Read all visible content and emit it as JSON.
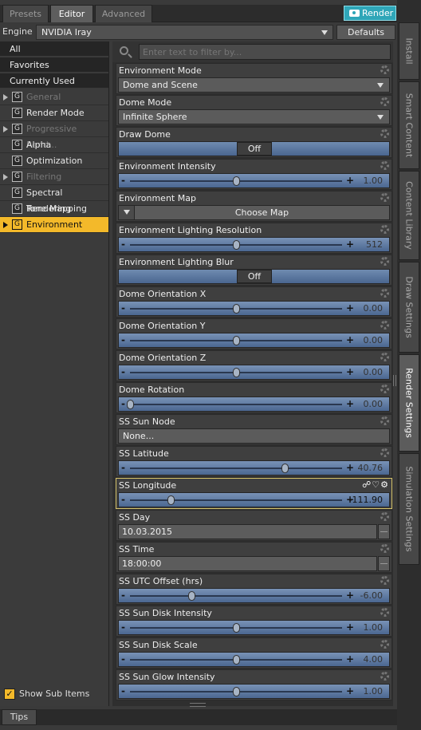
{
  "tabs": {
    "presets": "Presets",
    "editor": "Editor",
    "advanced": "Advanced"
  },
  "render_button": "Render",
  "engine": {
    "label": "Engine :",
    "value": "NVIDIA Iray",
    "defaults": "Defaults"
  },
  "filter": {
    "placeholder": "Enter text to filter by..."
  },
  "categories": [
    "All",
    "Favorites",
    "Currently Used"
  ],
  "nav": [
    {
      "label": "General"
    },
    {
      "label": "Render Mode"
    },
    {
      "label": "Progressive Rend..."
    },
    {
      "label": "Alpha"
    },
    {
      "label": "Optimization"
    },
    {
      "label": "Filtering"
    },
    {
      "label": "Spectral Rendering"
    },
    {
      "label": "Tone Mapping"
    },
    {
      "label": "Environment"
    }
  ],
  "group_icon": "G",
  "show_sub_items": "Show Sub Items",
  "tips": "Tips",
  "props": {
    "env_mode": {
      "label": "Environment Mode",
      "value": "Dome and Scene"
    },
    "dome_mode": {
      "label": "Dome Mode",
      "value": "Infinite Sphere"
    },
    "draw_dome": {
      "label": "Draw Dome",
      "value": "Off"
    },
    "env_intensity": {
      "label": "Environment Intensity",
      "value": "1.00",
      "level": 0.5
    },
    "env_map": {
      "label": "Environment Map",
      "value": "Choose Map"
    },
    "env_res": {
      "label": "Environment Lighting Resolution",
      "value": "512",
      "level": 0.5
    },
    "env_blur": {
      "label": "Environment Lighting Blur",
      "value": "Off"
    },
    "dome_x": {
      "label": "Dome Orientation X",
      "value": "0.00",
      "level": 0.5
    },
    "dome_y": {
      "label": "Dome Orientation Y",
      "value": "0.00",
      "level": 0.5
    },
    "dome_z": {
      "label": "Dome Orientation Z",
      "value": "0.00",
      "level": 0.5
    },
    "dome_rot": {
      "label": "Dome Rotation",
      "value": "0.00",
      "level": 0.0
    },
    "sun_node": {
      "label": "SS Sun Node",
      "value": "None..."
    },
    "latitude": {
      "label": "SS Latitude",
      "value": "40.76",
      "level": 0.73
    },
    "longitude": {
      "label": "SS Longitude",
      "value": "-111.90",
      "level": 0.19
    },
    "day": {
      "label": "SS Day",
      "value": "10.03.2015"
    },
    "time": {
      "label": "SS Time",
      "value": "18:00:00"
    },
    "utc": {
      "label": "SS UTC Offset (hrs)",
      "value": "-6.00",
      "level": 0.29
    },
    "disk_intensity": {
      "label": "SS Sun Disk Intensity",
      "value": "1.00",
      "level": 0.5
    },
    "disk_scale": {
      "label": "SS Sun Disk Scale",
      "value": "4.00",
      "level": 0.5
    },
    "glow_intensity": {
      "label": "SS Sun Glow Intensity",
      "value": "1.00",
      "level": 0.5
    }
  },
  "longitude_icons": "☍♡⚙",
  "vtabs": [
    "Install",
    "Smart Content",
    "Content Library",
    "Draw Settings",
    "Render Settings",
    "Simulation Settings"
  ]
}
